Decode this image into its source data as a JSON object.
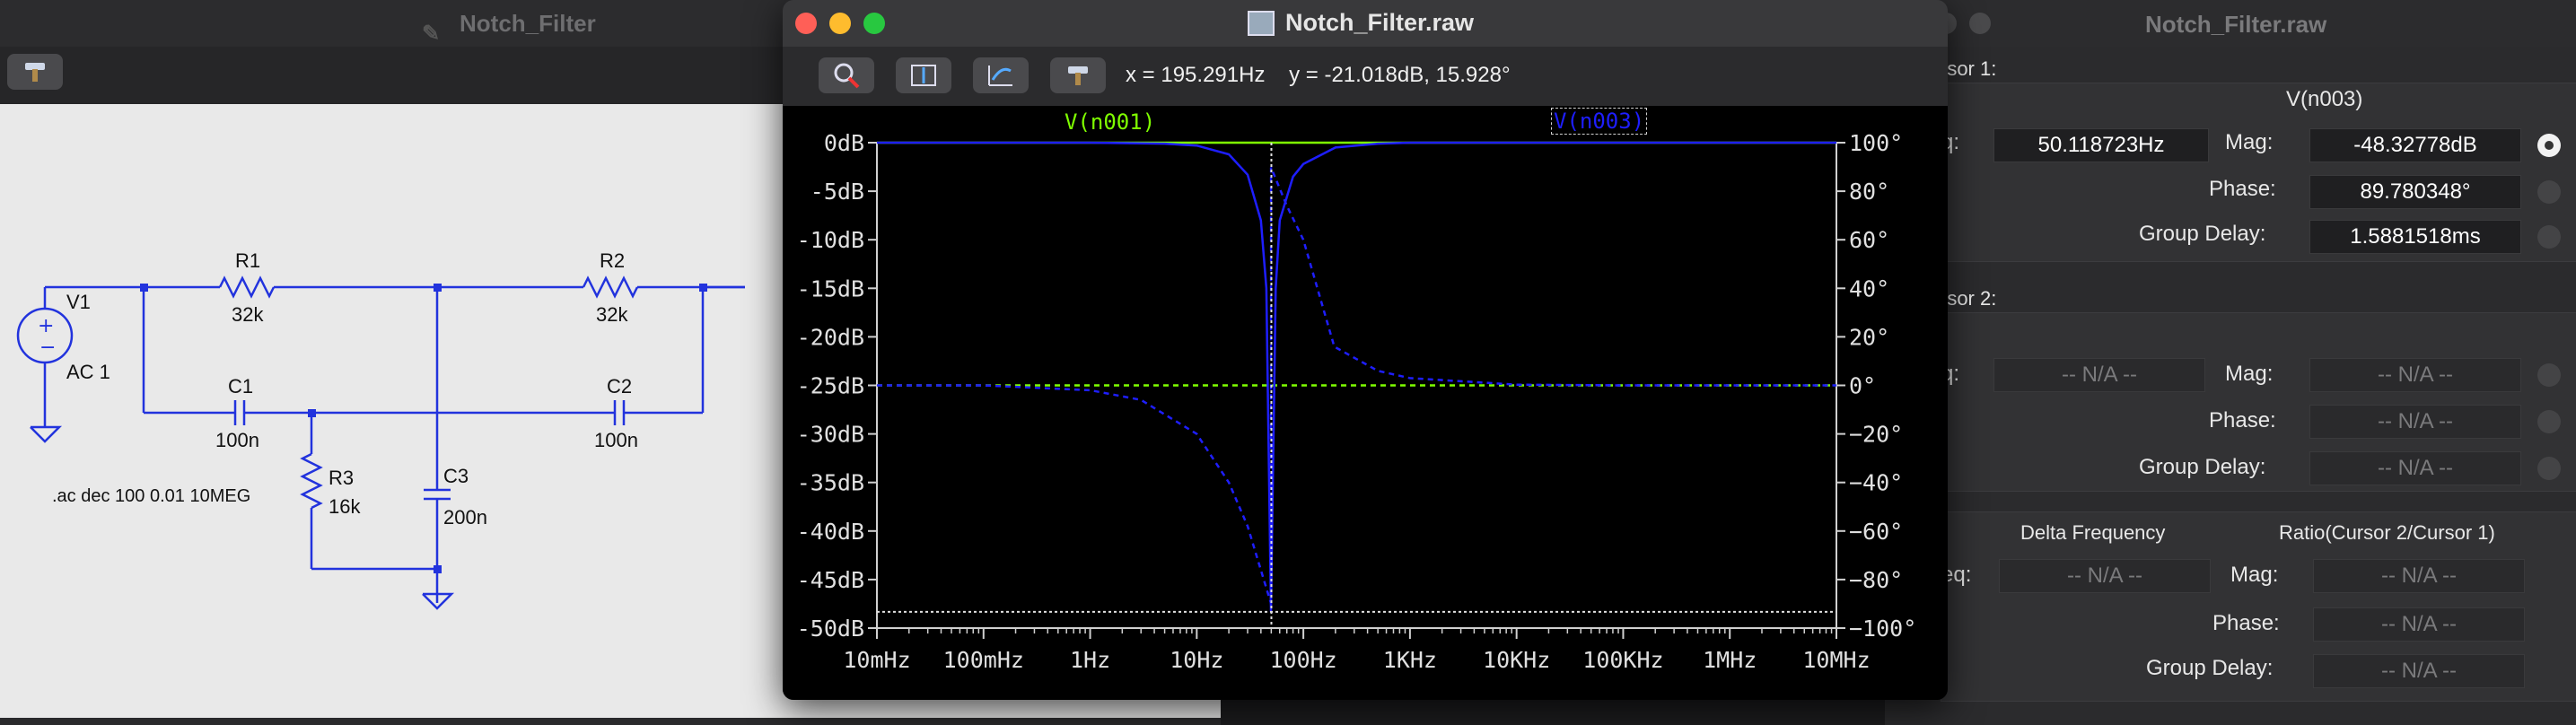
{
  "schematic": {
    "title": "Notch_Filter",
    "components": {
      "v1_name": "V1",
      "v1_value": "AC 1",
      "r1_name": "R1",
      "r1_value": "32k",
      "r2_name": "R2",
      "r2_value": "32k",
      "r3_name": "R3",
      "r3_value": "16k",
      "c1_name": "C1",
      "c1_value": "100n",
      "c2_name": "C2",
      "c2_value": "100n",
      "c3_name": "C3",
      "c3_value": "200n"
    },
    "directive": ".ac dec 100 0.01 10MEG"
  },
  "plot": {
    "title": "Notch_Filter.raw",
    "cursor_readout": "x = 195.291Hz    y = -21.018dB, 15.928°",
    "traces": [
      {
        "name": "V(n001)",
        "color": "#7fff00"
      },
      {
        "name": "V(n003)",
        "color": "#1e1eff"
      }
    ],
    "left_ticks": [
      "0dB",
      "-5dB",
      "-10dB",
      "-15dB",
      "-20dB",
      "-25dB",
      "-30dB",
      "-35dB",
      "-40dB",
      "-45dB",
      "-50dB"
    ],
    "right_ticks": [
      "100°",
      "80°",
      "60°",
      "40°",
      "20°",
      "0°",
      "−20°",
      "−40°",
      "−60°",
      "−80°",
      "−100°"
    ],
    "x_ticks": [
      "10mHz",
      "100mHz",
      "1Hz",
      "10Hz",
      "100Hz",
      "1KHz",
      "10KHz",
      "100KHz",
      "1MHz",
      "10MHz"
    ],
    "icons": [
      "zoom-icon",
      "autorange-icon",
      "pan-icon",
      "hammer-icon"
    ]
  },
  "chart_data": {
    "type": "line",
    "x_scale": "log",
    "x_label_unit": "Hz",
    "xlim": [
      0.01,
      10000000
    ],
    "ylim_magnitude_db": [
      -50,
      0
    ],
    "ylim_phase_deg": [
      -100,
      100
    ],
    "grid": false,
    "legend": "top",
    "series": [
      {
        "name": "V(n001)",
        "quantity": "magnitude",
        "x": [
          0.01,
          10000000
        ],
        "values": [
          0,
          0
        ]
      },
      {
        "name": "V(n001)",
        "quantity": "phase",
        "style": "dashed",
        "x": [
          0.01,
          10000000
        ],
        "values": [
          0,
          0
        ]
      },
      {
        "name": "V(n003)",
        "quantity": "magnitude",
        "x": [
          0.01,
          1,
          5,
          10,
          20,
          30,
          40,
          45,
          49.7,
          55,
          60,
          80,
          100,
          200,
          500,
          1000,
          10000000
        ],
        "values": [
          0,
          0,
          -0.1,
          -0.3,
          -1.2,
          -3.3,
          -8,
          -15,
          -48.3,
          -15,
          -8,
          -3.5,
          -2.2,
          -0.5,
          -0.1,
          0,
          0
        ]
      },
      {
        "name": "V(n003)",
        "quantity": "phase",
        "style": "dashed",
        "x": [
          0.01,
          0.1,
          1,
          3,
          10,
          20,
          30,
          49.7,
          49.8,
          70,
          100,
          195.291,
          500,
          1000,
          10000,
          100000,
          10000000
        ],
        "values": [
          0,
          0,
          -2,
          -6,
          -20,
          -40,
          -58,
          -89.8,
          89.8,
          74,
          60,
          15.928,
          6,
          3,
          0.3,
          0,
          0
        ]
      }
    ],
    "cursor": {
      "x": 50.118723,
      "magnitude_db": -48.32778,
      "phase_deg": 89.780348
    }
  },
  "cursor_panel": {
    "title": "Notch_Filter.raw",
    "cursor1_label": "rsor 1:",
    "trace_name": "V(n003)",
    "freq_label": "q:",
    "mag_label": "Mag:",
    "phase_label": "Phase:",
    "gd_label": "Group Delay:",
    "c1_freq": "50.118723Hz",
    "c1_mag": "-48.32778dB",
    "c1_phase": "89.780348°",
    "c1_gd": "1.5881518ms",
    "cursor2_label": "rsor 2:",
    "na": "-- N/A --",
    "delta_freq_label": "Delta Frequency",
    "ratio_label": "Ratio(Cursor 2/Cursor 1)",
    "delta_freq_field_label": "eq:"
  }
}
